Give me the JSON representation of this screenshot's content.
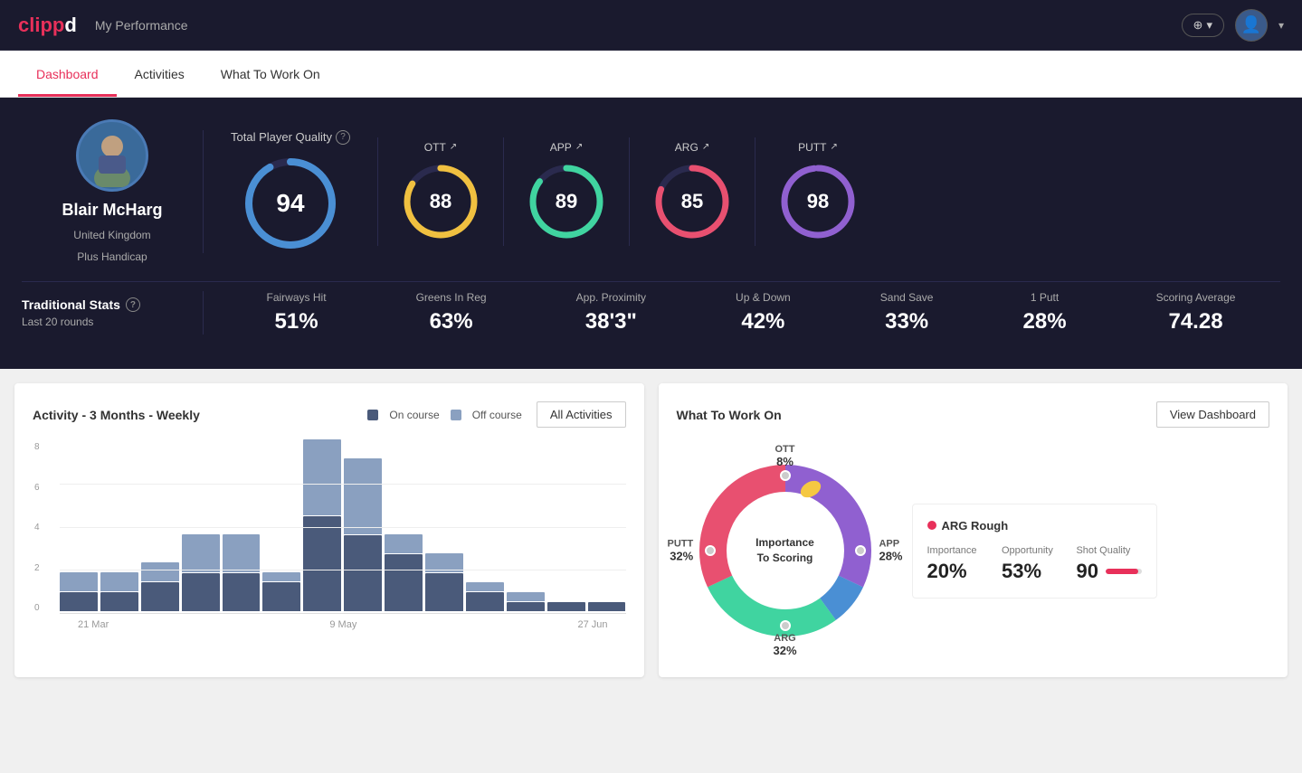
{
  "app": {
    "logo": "clippd",
    "logo_color": "clipd",
    "title": "My Performance"
  },
  "nav": {
    "tabs": [
      {
        "label": "Dashboard",
        "active": true
      },
      {
        "label": "Activities",
        "active": false
      },
      {
        "label": "What To Work On",
        "active": false
      }
    ]
  },
  "player": {
    "name": "Blair McHarg",
    "location": "United Kingdom",
    "handicap": "Plus Handicap"
  },
  "total_quality": {
    "label": "Total Player Quality",
    "value": 94,
    "color": "#4a8fd4"
  },
  "metrics": [
    {
      "key": "OTT",
      "value": 88,
      "color": "#f0c040",
      "label": "OTT"
    },
    {
      "key": "APP",
      "value": 89,
      "color": "#40d4a0",
      "label": "APP"
    },
    {
      "key": "ARG",
      "value": 85,
      "color": "#e85070",
      "label": "ARG"
    },
    {
      "key": "PUTT",
      "value": 98,
      "color": "#9060d0",
      "label": "PUTT"
    }
  ],
  "trad_stats": {
    "label": "Traditional Stats",
    "period": "Last 20 rounds",
    "items": [
      {
        "label": "Fairways Hit",
        "value": "51%"
      },
      {
        "label": "Greens In Reg",
        "value": "63%"
      },
      {
        "label": "App. Proximity",
        "value": "38'3\""
      },
      {
        "label": "Up & Down",
        "value": "42%"
      },
      {
        "label": "Sand Save",
        "value": "33%"
      },
      {
        "label": "1 Putt",
        "value": "28%"
      },
      {
        "label": "Scoring Average",
        "value": "74.28"
      }
    ]
  },
  "activity_chart": {
    "title": "Activity - 3 Months - Weekly",
    "legend": [
      {
        "label": "On course",
        "color": "#4a5a7a"
      },
      {
        "label": "Off course",
        "color": "#8aa0c0"
      }
    ],
    "all_activities_btn": "All Activities",
    "x_labels": [
      "21 Mar",
      "9 May",
      "27 Jun"
    ],
    "y_labels": [
      "0",
      "2",
      "4",
      "6",
      "8"
    ],
    "bars": [
      {
        "on": 1,
        "off": 1
      },
      {
        "on": 1,
        "off": 1
      },
      {
        "on": 1.5,
        "off": 1
      },
      {
        "on": 2,
        "off": 2
      },
      {
        "on": 2,
        "off": 2
      },
      {
        "on": 1.5,
        "off": 0.5
      },
      {
        "on": 5,
        "off": 4
      },
      {
        "on": 4,
        "off": 4
      },
      {
        "on": 3,
        "off": 1
      },
      {
        "on": 2,
        "off": 1
      },
      {
        "on": 1,
        "off": 0.5
      },
      {
        "on": 0.5,
        "off": 0.5
      },
      {
        "on": 0.5,
        "off": 0
      },
      {
        "on": 0.5,
        "off": 0
      }
    ]
  },
  "what_to_work_on": {
    "title": "What To Work On",
    "view_dashboard_btn": "View Dashboard",
    "donut_center": "Importance\nTo Scoring",
    "segments": [
      {
        "label": "OTT",
        "value": "8%",
        "color": "#4a8fd4",
        "pos": "top"
      },
      {
        "label": "APP",
        "value": "28%",
        "color": "#40d4a0",
        "pos": "right"
      },
      {
        "label": "ARG",
        "value": "32%",
        "color": "#e85070",
        "pos": "bottom"
      },
      {
        "label": "PUTT",
        "value": "32%",
        "color": "#9060d0",
        "pos": "left"
      }
    ],
    "card": {
      "title": "ARG Rough",
      "dot_color": "#e85070",
      "metrics": [
        {
          "label": "Importance",
          "value": "20%"
        },
        {
          "label": "Opportunity",
          "value": "53%"
        },
        {
          "label": "Shot Quality",
          "value": "90",
          "show_bar": true
        }
      ]
    }
  }
}
